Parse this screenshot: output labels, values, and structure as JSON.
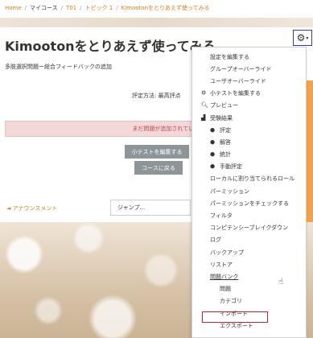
{
  "breadcrumb": {
    "home": "Home",
    "sep1": "/",
    "my_courses": "マイコース",
    "sep2": "/",
    "course": "T01",
    "sep3": "/",
    "topic": "トピック 1",
    "sep4": "/",
    "current": "Kimootonをとりあえず使ってみる"
  },
  "page": {
    "title": "Kimootonをとりあえず使ってみる",
    "subtitle": "多肢選択問題ー総合フィードバックの追加",
    "grade_method": "評定方法: 最高評点",
    "alert": "まだ問題が追加されていませ",
    "edit_quiz_button": "小テストを編集する",
    "back_to_course_button": "コースに戻る",
    "announcements_link": "◄ アナウンスメント",
    "jump_select": "ジャンプ..."
  },
  "menu": {
    "items": [
      {
        "label": "設定を編集する",
        "icon": ""
      },
      {
        "label": "グループオーバーライド",
        "icon": ""
      },
      {
        "label": "ユーザオーバーライド",
        "icon": ""
      },
      {
        "label": "小テストを編集する",
        "icon": "gear-icon"
      },
      {
        "label": "プレビュー",
        "icon": "magnifier-icon"
      },
      {
        "label": "受験結果",
        "icon": "chart-icon"
      },
      {
        "label": "評定",
        "icon": "bullet"
      },
      {
        "label": "解答",
        "icon": "bullet"
      },
      {
        "label": "統計",
        "icon": "bullet"
      },
      {
        "label": "手動評定",
        "icon": "bullet"
      },
      {
        "label": "ローカルに割り当てられるロール",
        "icon": ""
      },
      {
        "label": "パーミッション",
        "icon": ""
      },
      {
        "label": "パーミッションをチェックする",
        "icon": ""
      },
      {
        "label": "フィルタ",
        "icon": ""
      },
      {
        "label": "コンピテンシーブレイクダウン",
        "icon": ""
      },
      {
        "label": "ログ",
        "icon": ""
      },
      {
        "label": "バックアップ",
        "icon": ""
      },
      {
        "label": "リストア",
        "icon": ""
      },
      {
        "label": "問題バンク",
        "icon": ""
      },
      {
        "label": "問題",
        "icon": ""
      },
      {
        "label": "カテゴリ",
        "icon": ""
      },
      {
        "label": "インポート",
        "icon": ""
      },
      {
        "label": "エクスポート",
        "icon": ""
      }
    ]
  },
  "colors": {
    "accent": "#e07b1a",
    "alert_bg": "#f4d7d8",
    "button_bg": "#8d9599",
    "highlight": "#c8202a",
    "gear_border": "#2c3ea8"
  }
}
